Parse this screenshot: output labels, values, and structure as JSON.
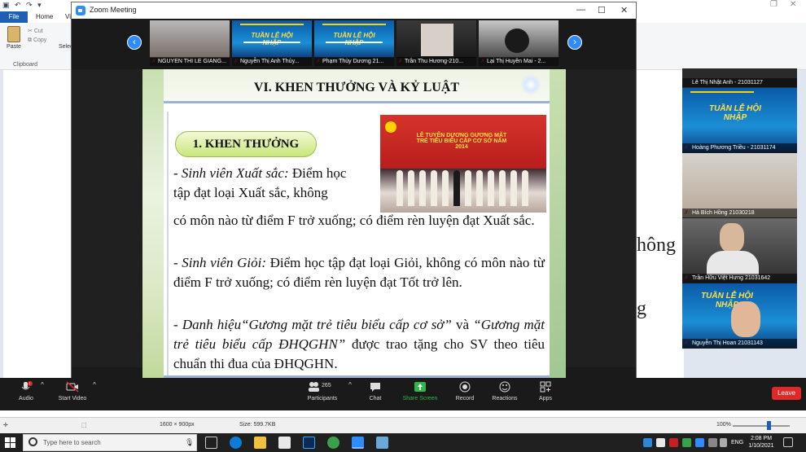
{
  "paint": {
    "tabs": [
      "File",
      "Home",
      "Vi"
    ],
    "ribbon": {
      "paste": "Paste",
      "cut": "Cut",
      "copy": "Copy",
      "select": "Selec",
      "group": "Clipboard"
    },
    "bg_text_1": "hông",
    "bg_text_2": "g",
    "status": {
      "dims": "1600 × 900px",
      "size": "Size: 599.7KB",
      "zoom": "100%"
    }
  },
  "zoom": {
    "window_title": "Zoom Meeting",
    "gallery": [
      {
        "name": "NGUYEN THI LE GIANG..."
      },
      {
        "name": "Nguyễn Thị Anh Thủy..."
      },
      {
        "name": "Phạm Thùy Dương 21..."
      },
      {
        "name": "Trần Thu Hương-210..."
      },
      {
        "name": "Lại Thị Huyền Mai - 2..."
      }
    ],
    "banner_text": "TUẦN LỄ HỘI NHẬP",
    "slide": {
      "title": "VI. KHEN THƯỞNG VÀ KỶ LUẬT",
      "pill": "1. KHEN THƯỞNG",
      "photo_text": "LỄ TUYÊN DƯƠNG GƯƠNG MẶT TRẺ TIÊU BIỂU CẤP CƠ SỞ NĂM 2014",
      "p1_label": "Sinh viên Xuất sắc:",
      "p1_a": "Điểm học",
      "p1_b": "tập đạt loại Xuất sắc, không",
      "p1_c": "có môn nào từ điểm F trở xuống; có điểm rèn luyện đạt Xuất sắc.",
      "p2_label": "Sinh viên Giỏi:",
      "p2_text": "Điểm học tập đạt loại Giỏi, không có môn nào từ điểm F trở xuống; có điểm rèn luyện đạt Tốt trở lên.",
      "p3_a": "Danh hiệu“Gương mặt trẻ tiêu biểu cấp cơ sở”",
      "p3_b": "và",
      "p3_c": "“Gương mặt trẻ tiêu biểu cấp ĐHQGHN”",
      "p3_d": "được trao tặng cho SV theo tiêu chuẩn thi đua của ĐHQGHN."
    },
    "participants_panel": [
      {
        "name": "Lê Thị Nhật Anh - 21031127"
      },
      {
        "name": "Hoàng Phương Triều - 21031174"
      },
      {
        "name": "Hà Bích Hồng 21030218"
      },
      {
        "name": "Trần Hữu Việt Hưng 21031642"
      },
      {
        "name": "Nguyễn Thị Hoan 21031143"
      }
    ],
    "toolbar": {
      "audio": "Audio",
      "video": "Start Video",
      "participants": "Participants",
      "participants_count": "265",
      "chat": "Chat",
      "share": "Share Screen",
      "record": "Record",
      "reactions": "Reactions",
      "apps": "Apps",
      "leave": "Leave",
      "audio_badge": "!"
    }
  },
  "taskbar": {
    "search_placeholder": "Type here to search",
    "language": "ENG",
    "time": "2:08 PM",
    "date": "1/10/2021"
  }
}
